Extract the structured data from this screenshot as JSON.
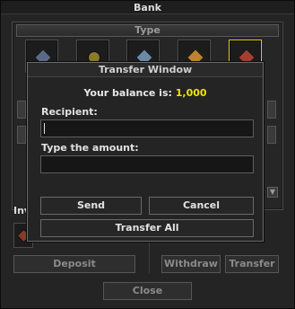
{
  "bank": {
    "title": "Bank",
    "type_header": "Type",
    "inventory_label": "Inv",
    "deposit_label": "Deposit",
    "withdraw_label": "Withdraw",
    "transfer_label": "Transfer",
    "close_label": "Close"
  },
  "type_slots": [
    {
      "icon": "dark-gem-icon",
      "color": "#5a6a86"
    },
    {
      "icon": "gold-gem-icon",
      "color": "#8a7a2a"
    },
    {
      "icon": "blue-gem-icon",
      "color": "#6a8aa6"
    },
    {
      "icon": "amber-gem-icon",
      "color": "#b8862e"
    },
    {
      "icon": "red-gem-icon",
      "color": "#a04030",
      "selected": true
    }
  ],
  "transfer": {
    "title": "Transfer Window",
    "balance_label": "Your balance is:",
    "balance_value": "1,000",
    "recipient_label": "Recipient:",
    "recipient_value": "",
    "amount_label": "Type the amount:",
    "amount_value": "",
    "send_label": "Send",
    "cancel_label": "Cancel",
    "transfer_all_label": "Transfer All"
  }
}
